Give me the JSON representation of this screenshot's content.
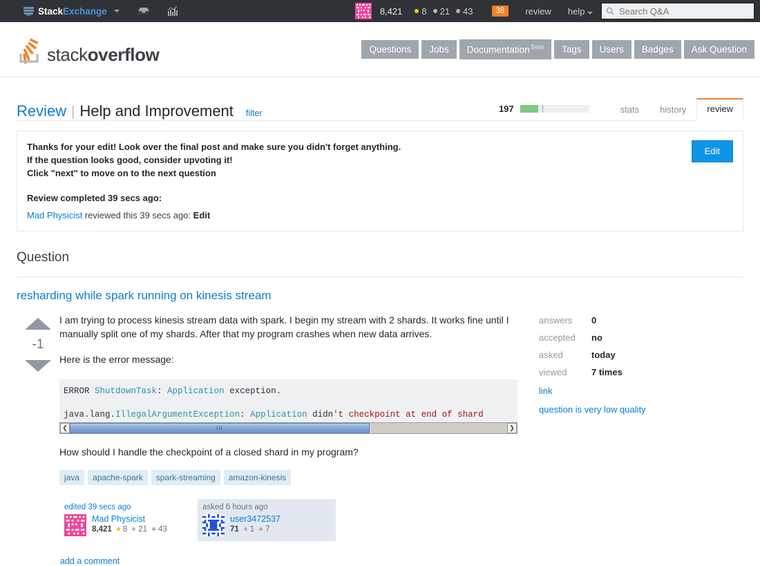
{
  "topbar": {
    "site_name_part1": "Stack",
    "site_name_part2": "Exchange",
    "inbox_icon": "inbox-icon",
    "achievements_icon": "achievements-chart-icon",
    "reputation": "8,421",
    "gold": "8",
    "silver": "21",
    "bronze": "43",
    "notifications": "38",
    "review_link": "review",
    "help_link": "help",
    "search_placeholder": "Search Q&A",
    "search_value": "",
    "search_icon": "search-icon"
  },
  "header": {
    "logo_text_light": "stack",
    "logo_text_bold": "overflow",
    "nav": [
      {
        "label": "Questions",
        "sup": ""
      },
      {
        "label": "Jobs",
        "sup": ""
      },
      {
        "label": "Documentation",
        "sup": "Beta"
      },
      {
        "label": "Tags",
        "sup": ""
      },
      {
        "label": "Users",
        "sup": ""
      },
      {
        "label": "Badges",
        "sup": ""
      },
      {
        "label": "Ask Question",
        "sup": ""
      }
    ]
  },
  "review": {
    "title_link": "Review",
    "separator": "|",
    "queue_name": "Help and Improvement",
    "filter_label": "filter",
    "remaining_count": "197",
    "progress_percent": 26,
    "tabs": [
      {
        "label": "stats",
        "active": false
      },
      {
        "label": "history",
        "active": false
      },
      {
        "label": "review",
        "active": true
      }
    ]
  },
  "banner": {
    "line1": "Thanks for your edit! Look over the final post and make sure you didn't forget anything.",
    "line2": "If the question looks good, consider upvoting it!",
    "line3": "Click \"next\" to move on to the next question",
    "completed_heading": "Review completed 39 secs ago:",
    "reviewer_name": "Mad Physicist",
    "reviewed_text": "reviewed this 39 secs ago:",
    "review_action": "Edit",
    "edit_button": "Edit"
  },
  "question": {
    "section_heading": "Question",
    "title": "resharding while spark running on kinesis stream",
    "vote_score": "-1",
    "paragraph1": "I am trying to process kinesis stream data with spark. I begin my stream with 2 shards. It works fine until I manually split one of my shards. After that my program crashes when new data arrives.",
    "paragraph2": "Here is the error message:",
    "code": {
      "line1_plain1": "ERROR ",
      "line1_cls1": "ShutdownTask",
      "line1_plain2": ": ",
      "line1_cls2": "Application",
      "line1_plain3": " exception.",
      "line2_plain1": "java.lang.",
      "line2_cls1": "IllegalArgumentException",
      "line2_plain2": ": ",
      "line2_cls2": "Application",
      "line2_plain3": " didn",
      "line2_str": "'t checkpoint at end of shard",
      "scroll_grip": "III",
      "scroll_left_icon": "chevron-left-icon",
      "scroll_right_icon": "chevron-right-icon"
    },
    "paragraph3": "How should I handle the checkpoint of a closed shard in my program?",
    "tags": [
      "java",
      "apache-spark",
      "spark-streaming",
      "amazon-kinesis"
    ],
    "edited_card": {
      "time_label": "edited 39 secs ago",
      "user": "Mad Physicist",
      "rep": "8,421",
      "gold": "8",
      "silver": "21",
      "bronze": "43"
    },
    "asked_card": {
      "time_label": "asked 6 hours ago",
      "user": "user3472537",
      "rep": "71",
      "silver": "1",
      "bronze": "7"
    },
    "add_comment": "add a comment"
  },
  "sidebar": {
    "rows": [
      {
        "key": "answers",
        "value": "0"
      },
      {
        "key": "accepted",
        "value": "no"
      },
      {
        "key": "asked",
        "value": "today"
      },
      {
        "key": "viewed",
        "value": "7 times"
      }
    ],
    "link_label": "link",
    "flag_label": "question is very low quality"
  },
  "colors": {
    "accent_orange": "#f48024",
    "link_blue": "#0c7cd5",
    "topbar_bg": "#2f3337",
    "nav_gray": "#9fa6ad",
    "progress_green": "#82c785",
    "edit_button_blue": "#0d95e8"
  }
}
